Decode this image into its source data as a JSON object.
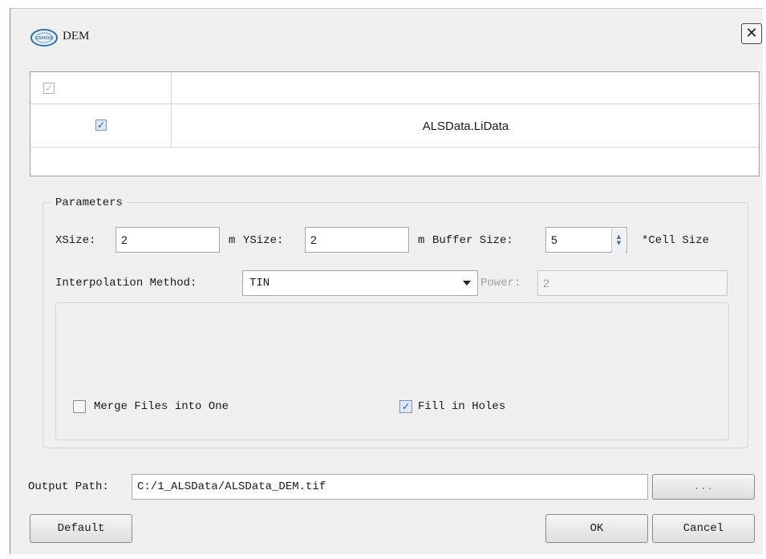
{
  "window": {
    "title": "DEM",
    "logo_text": "LIDAR360"
  },
  "close_icon": "close-icon",
  "table": {
    "rows": [
      {
        "checked": true,
        "name": "ALSData.LiData"
      }
    ]
  },
  "parameters": {
    "group_title": "Parameters",
    "xsize_label": "XSize:",
    "xsize_value": "2",
    "xsize_unit": "m",
    "ysize_label": "YSize:",
    "ysize_value": "2",
    "ysize_unit": "m",
    "buffer_label": "Buffer Size:",
    "buffer_value": "5",
    "buffer_suffix": "*Cell Size",
    "interp_label": "Interpolation Method:",
    "interp_value": "TIN",
    "power_label": "Power:",
    "power_value": "2",
    "merge_label": "Merge Files into One",
    "merge_checked": false,
    "fill_label": "Fill in Holes",
    "fill_checked": true
  },
  "output": {
    "label": "Output Path:",
    "value": "C:/1_ALSData/ALSData_DEM.tif",
    "browse_label": "..."
  },
  "buttons": {
    "default": "Default",
    "ok": "OK",
    "cancel": "Cancel"
  }
}
